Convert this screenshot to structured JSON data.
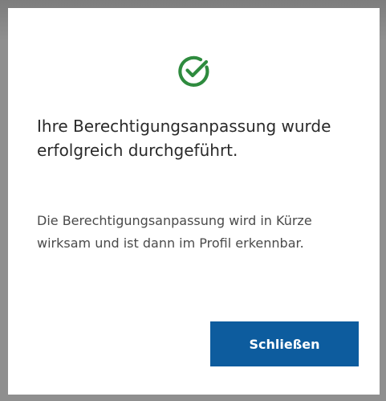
{
  "dialog": {
    "icon": "check-circle-icon",
    "accent_color": "#2e8b3e",
    "title": "Ihre Berechtigungsanpassung wurde erfolgreich durchgeführt.",
    "message": "Die Berechtigungsanpassung wird in Kürze wirksam und ist dann im Profil erkennbar.",
    "close_label": "Schließen",
    "button_color": "#0d5c9e"
  }
}
